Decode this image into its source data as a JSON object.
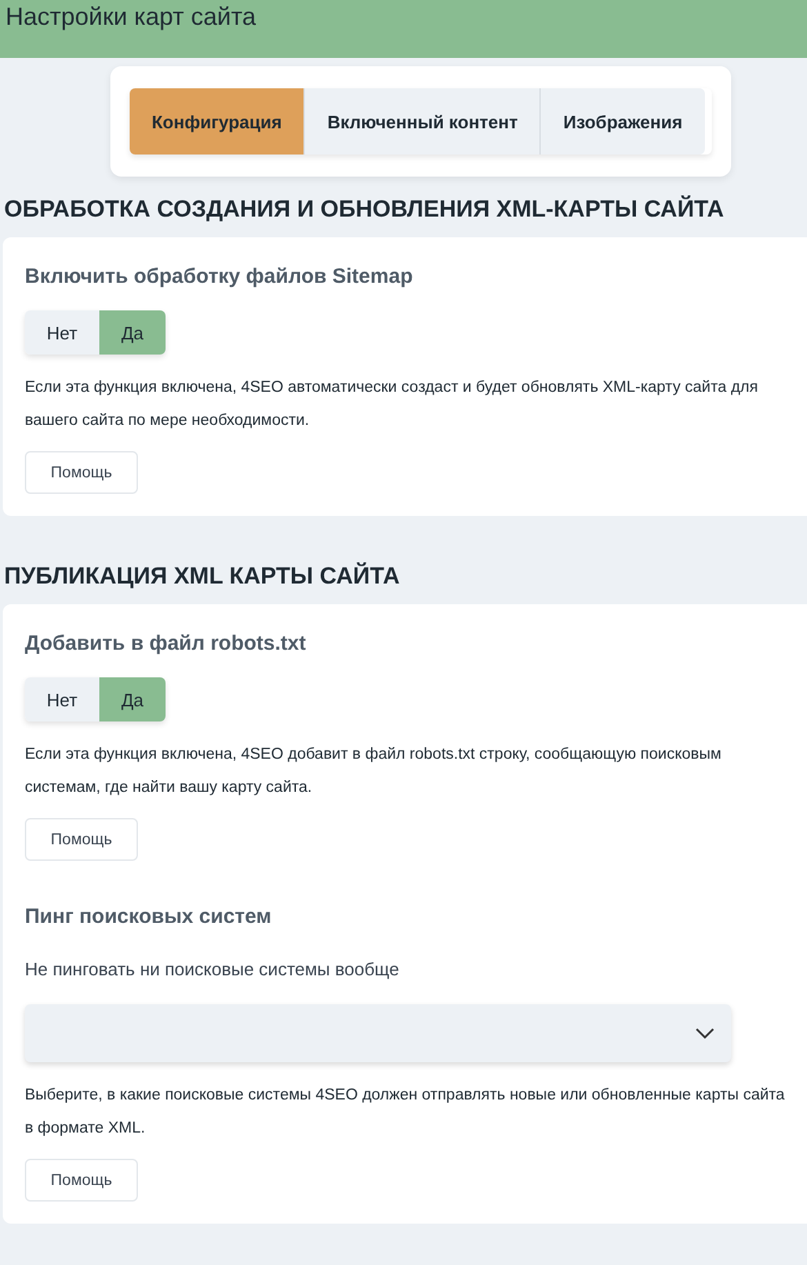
{
  "header": {
    "title": "Настройки карт сайта"
  },
  "tabs": [
    {
      "label": "Конфигурация",
      "selected": true
    },
    {
      "label": "Включенный контент",
      "selected": false
    },
    {
      "label": "Изображения",
      "selected": false
    }
  ],
  "sections": [
    {
      "title": "ОБРАБОТКА СОЗДАНИЯ И ОБНОВЛЕНИЯ XML-КАРТЫ САЙТА",
      "items": [
        {
          "kind": "toggle",
          "label": "Включить обработку файлов Sitemap",
          "options": [
            {
              "label": "Нет",
              "selected": false
            },
            {
              "label": "Да",
              "selected": true
            }
          ],
          "description": "Если эта функция включена, 4SEO автоматически создаст и будет обновлять XML-карту сайта для вашего сайта по мере необходимости.",
          "help": "Помощь"
        }
      ]
    },
    {
      "title": "ПУБЛИКАЦИЯ XML КАРТЫ САЙТА",
      "items": [
        {
          "kind": "toggle",
          "label": "Добавить в файл robots.txt",
          "options": [
            {
              "label": "Нет",
              "selected": false
            },
            {
              "label": "Да",
              "selected": true
            }
          ],
          "description": "Если эта функция включена, 4SEO добавит в файл robots.txt строку, сообщающую поисковым системам, где найти вашу карту сайта.",
          "help": "Помощь"
        },
        {
          "kind": "select",
          "label": "Пинг поисковых систем",
          "sublabel": "Не пинговать ни поисковые системы вообще",
          "description": "Выберите, в какие поисковые системы 4SEO должен отправлять новые или обновленные карты сайта в формате XML.",
          "help": "Помощь"
        }
      ]
    }
  ]
}
